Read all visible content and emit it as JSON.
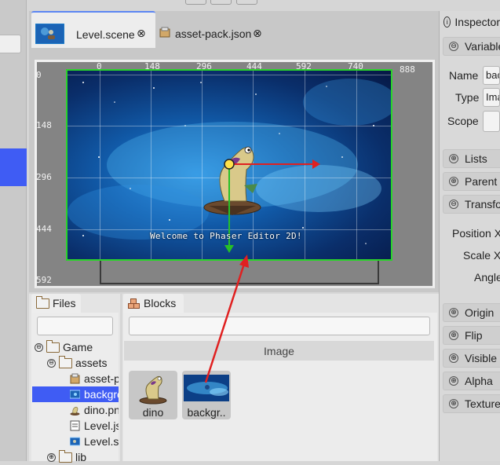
{
  "editor": {
    "tabs": [
      {
        "label": "Level.scene",
        "close": "⊗"
      },
      {
        "label": "asset-pack.json",
        "close": "⊗"
      }
    ],
    "rulers": {
      "x": [
        "0",
        "148",
        "296",
        "444",
        "592",
        "740",
        "888"
      ],
      "y": [
        "0",
        "148",
        "296",
        "444",
        "592"
      ]
    },
    "scene_text": "Welcome to Phaser Editor 2D!"
  },
  "inspector": {
    "title": "Inspector",
    "sections": {
      "variable": "Variable",
      "lists": "Lists",
      "parent": "Parent C",
      "transform": "Transform",
      "origin": "Origin",
      "flip": "Flip",
      "visible": "Visible",
      "alpha": "Alpha",
      "texture": "Texture"
    },
    "fields": {
      "name_label": "Name",
      "name_value": "background",
      "type_label": "Type",
      "type_value": "Image",
      "scope_label": "Scope",
      "scope_value": "",
      "position_label": "Position X",
      "scale_label": "Scale X",
      "angle_label": "Angle"
    },
    "expanded_sign": "⊖",
    "collapsed_sign": "⊕",
    "info_sign": "i"
  },
  "files": {
    "tab_label": "Files",
    "filter_placeholder": "",
    "tree": [
      {
        "label": "Game"
      },
      {
        "label": "assets"
      },
      {
        "label": "asset-pack.json"
      },
      {
        "label": "background.png"
      },
      {
        "label": "dino.png"
      },
      {
        "label": "Level.js"
      },
      {
        "label": "Level.scene"
      },
      {
        "label": "lib"
      }
    ],
    "toggle_open": "⊖",
    "toggle_closed": "⊕"
  },
  "blocks": {
    "tab_label": "Blocks",
    "filter_placeholder": "",
    "group_label": "Image",
    "items": [
      {
        "label": "dino"
      },
      {
        "label": "backgr.."
      }
    ]
  },
  "colors": {
    "selection": "#3f5cf4",
    "scene_border": "#2bd32b",
    "arrow_red": "#e02020",
    "tab_accent": "#5c86f2"
  }
}
